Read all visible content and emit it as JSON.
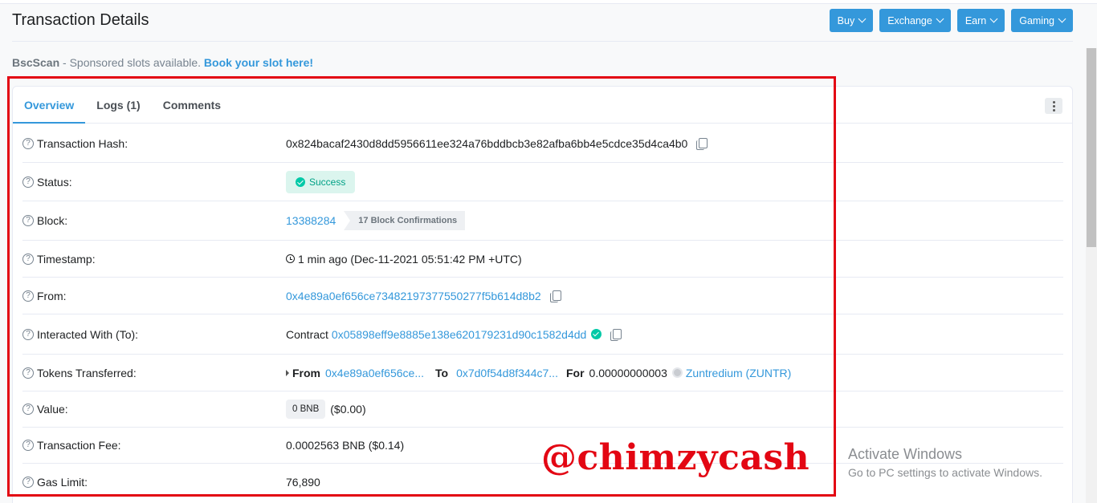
{
  "header": {
    "title": "Transaction Details",
    "menu": [
      {
        "label": "Buy"
      },
      {
        "label": "Exchange"
      },
      {
        "label": "Earn"
      },
      {
        "label": "Gaming"
      }
    ]
  },
  "sponsor": {
    "brand": "BscScan",
    "text": " - Sponsored slots available. ",
    "link": "Book your slot here!"
  },
  "tabs": [
    {
      "label": "Overview",
      "active": true
    },
    {
      "label": "Logs (1)"
    },
    {
      "label": "Comments"
    }
  ],
  "rows": {
    "hash": {
      "label": "Transaction Hash:",
      "value": "0x824bacaf2430d8dd5956611ee324a76bddbcb3e82afba6bb4e5cdce35d4ca4b0"
    },
    "status": {
      "label": "Status:",
      "value": "Success"
    },
    "block": {
      "label": "Block:",
      "value": "13388284",
      "confirmations": "17 Block Confirmations"
    },
    "timestamp": {
      "label": "Timestamp:",
      "value": "1 min ago (Dec-11-2021 05:51:42 PM +UTC)"
    },
    "from": {
      "label": "From:",
      "value": "0x4e89a0ef656ce73482197377550277f5b614d8b2"
    },
    "to": {
      "label": "Interacted With (To):",
      "prefix": "Contract",
      "value": "0x05898eff9e8885e138e620179231d90c1582d4dd"
    },
    "tokens": {
      "label": "Tokens Transferred:",
      "from_label": "From",
      "from": "0x4e89a0ef656ce...",
      "to_label": "To",
      "to": "0x7d0f54d8f344c7...",
      "for_label": "For",
      "amount": "0.00000000003",
      "token": "Zuntredium (ZUNTR)"
    },
    "value": {
      "label": "Value:",
      "amount": "0 BNB",
      "usd": "($0.00)"
    },
    "fee": {
      "label": "Transaction Fee:",
      "value": "0.0002563 BNB ($0.14)"
    },
    "gas": {
      "label": "Gas Limit:",
      "value": "76,890"
    }
  },
  "overlay": {
    "watermark": "@chimzycash",
    "activate_title": "Activate Windows",
    "activate_sub": "Go to PC settings to activate Windows."
  },
  "colors": {
    "accent": "#3498db",
    "success": "#00c9a7",
    "highlight": "#e30613"
  }
}
